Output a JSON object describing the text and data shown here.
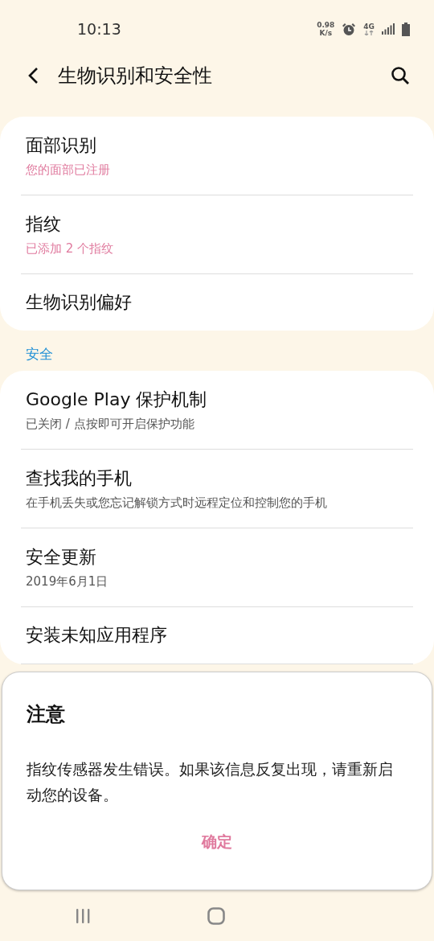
{
  "status_bar": {
    "time": "10:13",
    "speed_value": "0.98",
    "speed_unit": "K/s",
    "network": "4G"
  },
  "header": {
    "title": "生物识别和安全性"
  },
  "sections": [
    {
      "items": [
        {
          "title": "面部识别",
          "subtitle": "您的面部已注册",
          "color": "#e07a9e"
        },
        {
          "title": "指纹",
          "subtitle": "已添加 2 个指纹",
          "color": "#e07a9e"
        },
        {
          "title": "生物识别偏好"
        }
      ]
    },
    {
      "label": "安全",
      "items": [
        {
          "title": "Google Play 保护机制",
          "subtitle": "已关闭 / 点按即可开启保护功能",
          "color": "#555555"
        },
        {
          "title": "查找我的手机",
          "subtitle": "在手机丢失或您忘记解锁方式时远程定位和控制您的手机",
          "color": "#555555"
        },
        {
          "title": "安全更新",
          "subtitle": "2019年6月1日",
          "color": "#555555"
        },
        {
          "title": "安装未知应用程序"
        }
      ]
    }
  ],
  "dialog": {
    "title": "注意",
    "message": "指纹传感器发生错误。如果该信息反复出现，请重新启动您的设备。",
    "button": "确定"
  }
}
